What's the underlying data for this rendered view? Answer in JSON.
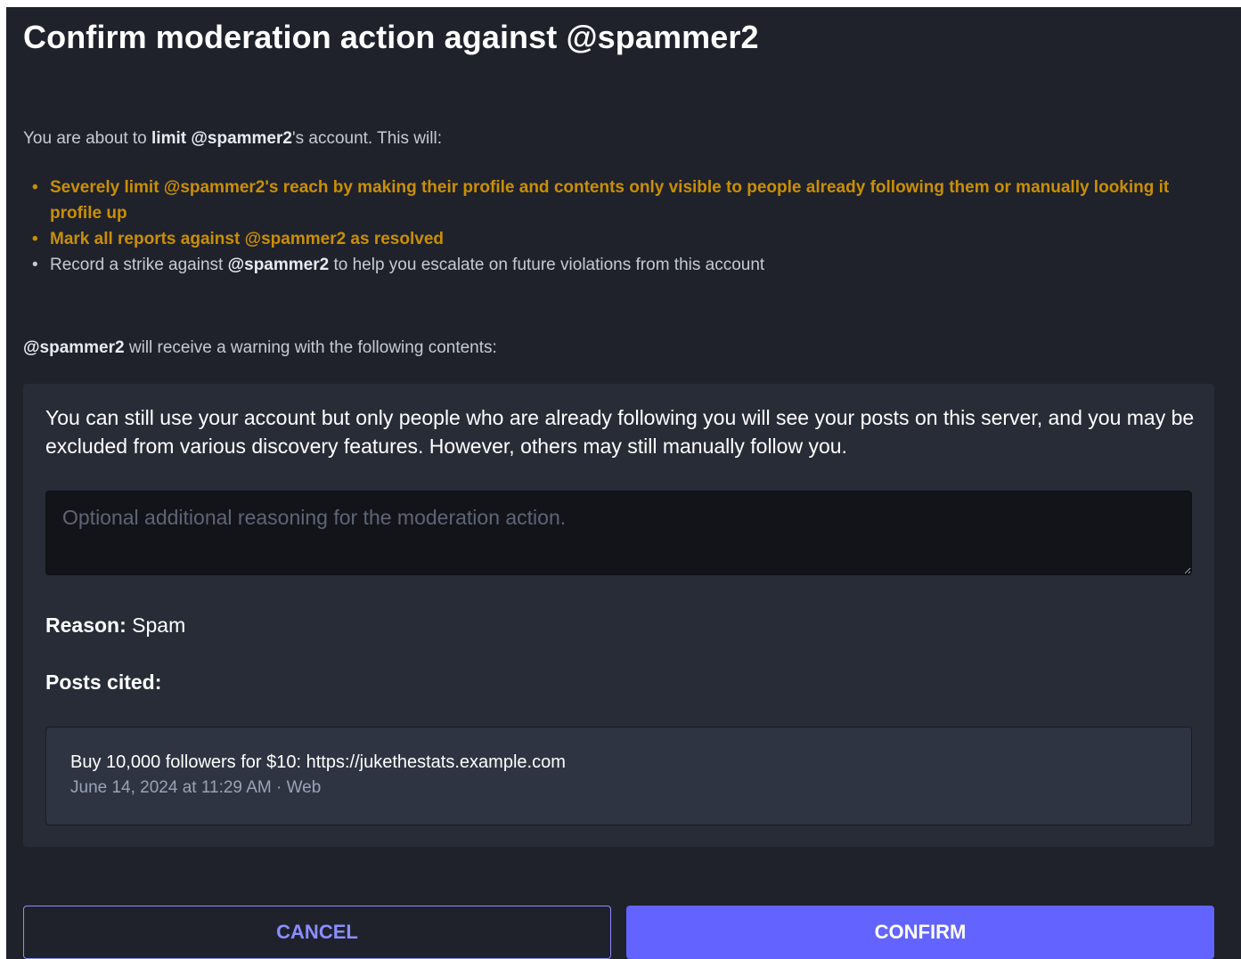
{
  "dialog": {
    "title": "Confirm moderation action against @spammer2"
  },
  "intro": {
    "prefix": "You are about to ",
    "action": "limit",
    "space": " ",
    "account": "@spammer2",
    "suffix": "'s account. This will:"
  },
  "consequences": [
    {
      "text": "Severely limit @spammer2's reach by making their profile and contents only visible to people already following them or manually looking it profile up",
      "highlight": true
    },
    {
      "text": "Mark all reports against @spammer2 as resolved",
      "highlight": true
    },
    {
      "prefix": "Record a strike against ",
      "account": "@spammer2",
      "suffix": " to help you escalate on future violations from this account",
      "highlight": false
    }
  ],
  "warning_intro": {
    "account": "@spammer2",
    "suffix": " will receive a warning with the following contents:"
  },
  "warning": {
    "text": "You can still use your account but only people who are already following you will see your posts on this server, and you may be excluded from various discovery features. However, others may still manually follow you.",
    "textarea_placeholder": "Optional additional reasoning for the moderation action.",
    "textarea_value": "",
    "reason_label": "Reason:",
    "reason_value": " Spam",
    "posts_label": "Posts cited:"
  },
  "posts_cited": [
    {
      "text": "Buy 10,000 followers for $10: https://jukethestats.example.com",
      "meta": "June 14, 2024 at 11:29 AM · Web"
    }
  ],
  "actions": {
    "cancel_label": "Cancel",
    "confirm_label": "Confirm"
  },
  "colors": {
    "modal_background": "#1f222b",
    "warning_box": "#282c37",
    "highlight_text": "#ca8f04",
    "accent": "#6364ff",
    "cancel_outline": "#8c8dff"
  }
}
